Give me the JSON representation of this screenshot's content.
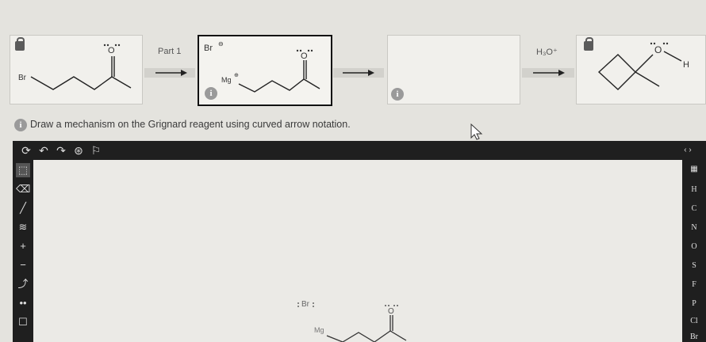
{
  "reaction": {
    "step_label": "Part 1",
    "reagent_label": "H₃O⁺",
    "info_glyph": "i",
    "start": {
      "br": "Br",
      "o": "O"
    },
    "grignard": {
      "br": "Br",
      "mg": "Mg",
      "o": "O"
    },
    "product": {
      "o": "O",
      "h": "H"
    }
  },
  "instruction": "Draw a mechanism on the Grignard reagent using curved arrow notation.",
  "toolbar": {
    "icons": [
      "refresh-icon",
      "undo-icon",
      "redo-icon",
      "zoom-icon",
      "template-icon"
    ],
    "expand": "‹ ›"
  },
  "left_tools": [
    "select-icon",
    "eraser-icon",
    "bond-icon",
    "chain-icon",
    "plus-charge-icon",
    "minus-charge-icon",
    "curved-arrow-icon",
    "lone-pair-icon",
    "box-icon"
  ],
  "elements": [
    "H",
    "C",
    "N",
    "O",
    "S",
    "F",
    "P",
    "Cl",
    "Br"
  ],
  "canvas": {
    "br": "Br",
    "mg": "Mg",
    "o": "O"
  },
  "colors": {
    "toolbar": "#1f1f1f",
    "canvas": "#ebeae6",
    "page": "#e4e3de"
  }
}
